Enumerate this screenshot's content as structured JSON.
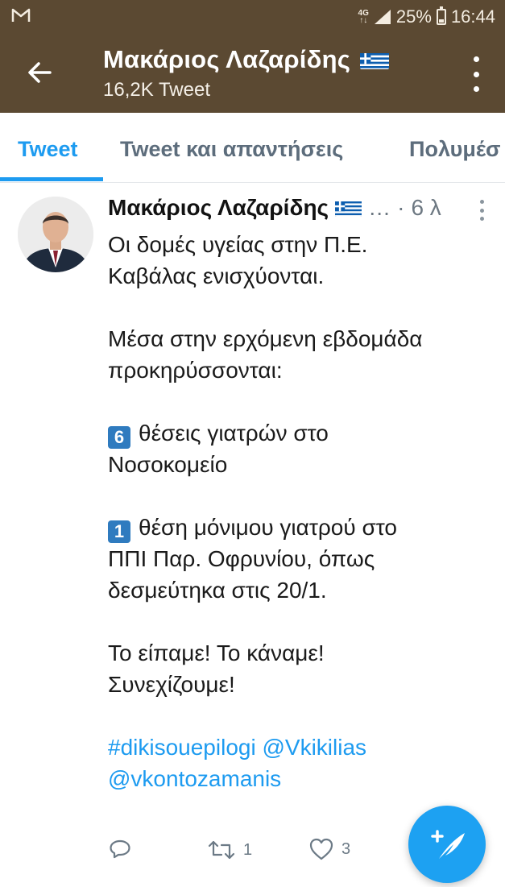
{
  "status_bar": {
    "network": "4G",
    "battery": "25%",
    "time": "16:44",
    "battery_level": 0.25
  },
  "header": {
    "name": "Μακάριος Λαζαρίδης",
    "tweet_count": "16,2K Tweet"
  },
  "tabs": [
    {
      "label": "Tweet",
      "active": true
    },
    {
      "label": "Tweet και απαντήσεις",
      "active": false
    },
    {
      "label": "Πολυμέσ",
      "active": false
    }
  ],
  "tweet": {
    "author": "Μακάριος Λαζαρίδης",
    "ellipsis": "…",
    "separator": "·",
    "time": "6 λ",
    "lines": [
      "Οι δομές υγείας στην Π.Ε.",
      "Καβάλας ενισχύονται.",
      "Μέσα στην ερχόμενη εβδομάδα",
      "προκηρύσσονται:"
    ],
    "item1": {
      "number": "6",
      "text1": "θέσεις γιατρών στο",
      "text2": "Νοσοκομείο"
    },
    "item2": {
      "number": "1",
      "text1": "θέση μόνιμου γιατρού στο",
      "text2": "ΠΠΙ Παρ. Οφρυνίου, όπως",
      "text3": "δεσμεύτηκα στις 20/1."
    },
    "closing": [
      "Το είπαμε! Το κάναμε!",
      "Συνεχίζουμε!"
    ],
    "hashtag": "#dikisouepilogi",
    "mention1": "@Vkikilias",
    "mention2": "@vkontozamanis",
    "retweets": "1",
    "likes": "3"
  },
  "colors": {
    "bar": "#5b4932",
    "accent": "#1d9bf0",
    "fab": "#1da1f2"
  }
}
